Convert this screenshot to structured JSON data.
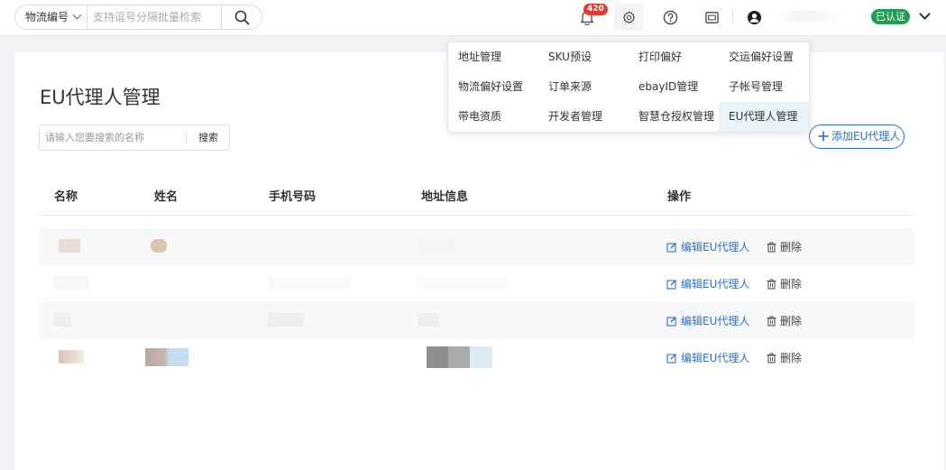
{
  "search": {
    "type_label": "物流编号",
    "placeholder": "支持逗号分隔批量检索"
  },
  "header": {
    "notification_count": "420",
    "verified_label": "已认证"
  },
  "settings_menu": {
    "items": [
      {
        "label": "地址管理"
      },
      {
        "label": "SKU预设"
      },
      {
        "label": "打印偏好"
      },
      {
        "label": "交运偏好设置"
      },
      {
        "label": "物流偏好设置"
      },
      {
        "label": "订单来源"
      },
      {
        "label": "ebayID管理"
      },
      {
        "label": "子帐号管理"
      },
      {
        "label": "带电资质"
      },
      {
        "label": "开发者管理"
      },
      {
        "label": "智慧仓授权管理"
      },
      {
        "label": "EU代理人管理"
      }
    ],
    "active_label": "EU代理人管理"
  },
  "page": {
    "title": "EU代理人管理",
    "name_search_placeholder": "请输入您要搜索的名称",
    "search_button": "搜索",
    "add_button": "添加EU代理人"
  },
  "table": {
    "columns": [
      "名称",
      "姓名",
      "手机号码",
      "地址信息",
      "操作"
    ],
    "rows": [
      {
        "edit_label": "编辑EU代理人",
        "delete_label": "删除"
      },
      {
        "edit_label": "编辑EU代理人",
        "delete_label": "删除"
      },
      {
        "edit_label": "编辑EU代理人",
        "delete_label": "删除"
      },
      {
        "edit_label": "编辑EU代理人",
        "delete_label": "删除"
      }
    ]
  },
  "colors": {
    "accent": "#2f6fc7",
    "verified": "#1f9d55",
    "badge": "#e5392f"
  },
  "icons": [
    "chevron-down-icon",
    "search-icon",
    "bell-icon",
    "gear-icon",
    "help-icon",
    "message-icon",
    "user-icon",
    "plus-icon",
    "edit-icon",
    "trash-icon"
  ]
}
